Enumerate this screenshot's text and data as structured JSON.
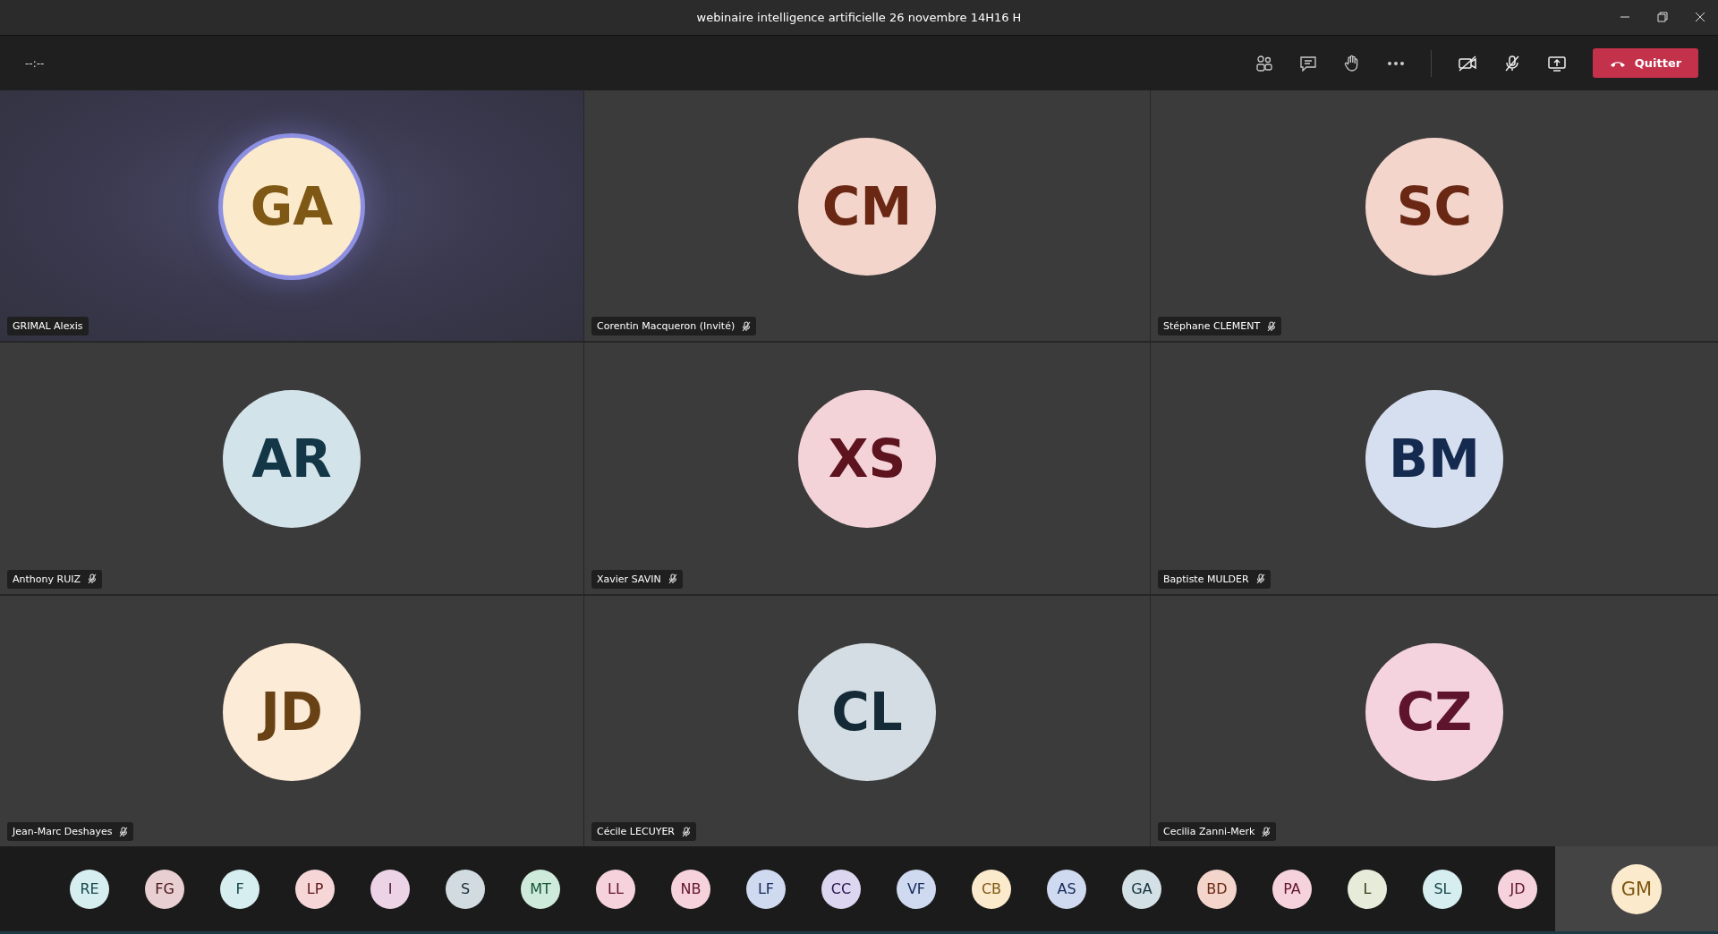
{
  "window": {
    "title": "webinaire intelligence artificielle 26 novembre 14H16 H"
  },
  "toolbar": {
    "timer": "--:--",
    "leave_button": "Quitter"
  },
  "tiles": [
    {
      "initials": "GA",
      "name": "GRIMAL Alexis",
      "muted": false,
      "speaking": true,
      "color": "#fbeacb"
    },
    {
      "initials": "CM",
      "name": "Corentin Macqueron (Invité)",
      "muted": true,
      "speaking": false,
      "color": "#f3d5cc"
    },
    {
      "initials": "SC",
      "name": "Stéphane CLEMENT",
      "muted": true,
      "speaking": false,
      "color": "#f3d5cc"
    },
    {
      "initials": "AR",
      "name": "Anthony RUIZ",
      "muted": true,
      "speaking": false,
      "color": "#d3e3ea"
    },
    {
      "initials": "XS",
      "name": "Xavier SAVIN",
      "muted": true,
      "speaking": false,
      "color": "#f4d3d8"
    },
    {
      "initials": "BM",
      "name": "Baptiste MULDER",
      "muted": true,
      "speaking": false,
      "color": "#d5dff0"
    },
    {
      "initials": "JD",
      "name": "Jean-Marc Deshayes",
      "muted": true,
      "speaking": false,
      "color": "#fcebd6"
    },
    {
      "initials": "CL",
      "name": "Cécile LECUYER",
      "muted": true,
      "speaking": false,
      "color": "#d3dde3"
    },
    {
      "initials": "CZ",
      "name": "Cecilia Zanni-Merk",
      "muted": true,
      "speaking": false,
      "color": "#f4d3de"
    }
  ],
  "strip": [
    {
      "initials": "RE",
      "color": "#d7eef0"
    },
    {
      "initials": "FG",
      "color": "#e8cfd2"
    },
    {
      "initials": "F",
      "color": "#d7eef0"
    },
    {
      "initials": "LP",
      "color": "#f6d6d6"
    },
    {
      "initials": "I",
      "color": "#ecd3e6"
    },
    {
      "initials": "S",
      "color": "#d2dce0"
    },
    {
      "initials": "MT",
      "color": "#cdeadb"
    },
    {
      "initials": "LL",
      "color": "#f6d3dc"
    },
    {
      "initials": "NB",
      "color": "#f6d3dc"
    },
    {
      "initials": "LF",
      "color": "#cfd9ef"
    },
    {
      "initials": "CC",
      "color": "#dcd6f0"
    },
    {
      "initials": "VF",
      "color": "#cfd9ef"
    },
    {
      "initials": "CB",
      "color": "#fbeacb"
    },
    {
      "initials": "AS",
      "color": "#cfd9ef"
    },
    {
      "initials": "GA",
      "color": "#d3e1e6"
    },
    {
      "initials": "BD",
      "color": "#f3d5cc"
    },
    {
      "initials": "PA",
      "color": "#f6d3dc"
    },
    {
      "initials": "L",
      "color": "#e6ecd9"
    },
    {
      "initials": "SL",
      "color": "#d7eef0"
    },
    {
      "initials": "JD",
      "color": "#f6d3dc"
    }
  ],
  "self": {
    "initials": "GM",
    "color": "#fbeacb"
  }
}
